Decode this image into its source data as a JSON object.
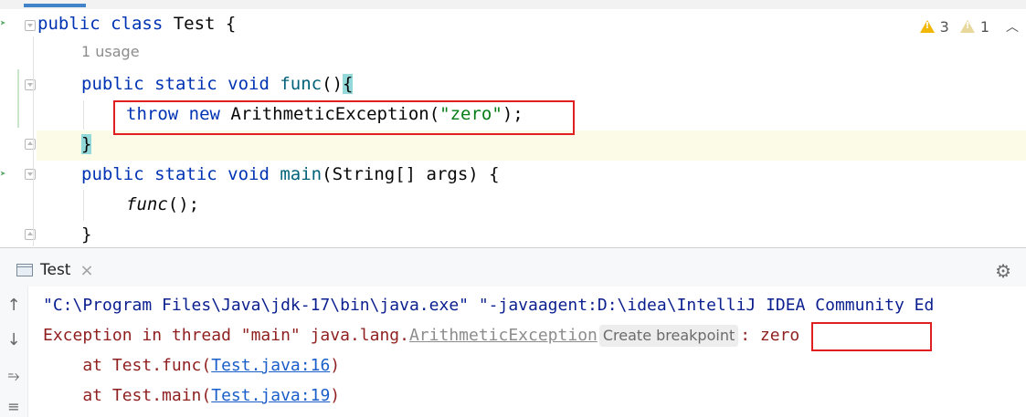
{
  "editor": {
    "lines": {
      "class_decl": {
        "kw": "public class",
        "rest": " Test {"
      },
      "usage_hint": "1 usage",
      "func_decl": {
        "kw": "public static void",
        "name": "func",
        "parens": "()",
        "brace": "{"
      },
      "throw_stmt": {
        "kw": "throw new",
        "type": " ArithmeticException(",
        "str": "\"zero\"",
        "end": ");"
      },
      "func_close": "}",
      "main_decl": {
        "kw": "public static void",
        "name": "main",
        "rest": "(String[] args) {"
      },
      "call": {
        "name": "func",
        "rest": "();"
      },
      "main_close": "}"
    },
    "inspections": {
      "warnings": "3",
      "weak_warnings": "1"
    }
  },
  "run": {
    "tab_label": "Test",
    "console": {
      "cmd_line": "\"C:\\Program Files\\Java\\jdk-17\\bin\\java.exe\" \"-javaagent:D:\\idea\\IntelliJ IDEA Community Ed",
      "exception": {
        "prefix": "Exception in thread \"main\" java.lang.",
        "class_link": "ArithmeticException",
        "breakpoint_btn": "Create breakpoint",
        "message": ": zero"
      },
      "trace": [
        {
          "at": "    at Test.func(",
          "link": "Test.java:16",
          "end": ")"
        },
        {
          "at": "    at Test.main(",
          "link": "Test.java:19",
          "end": ")"
        }
      ]
    }
  },
  "colors": {
    "keyword": "#0033b3",
    "function": "#00627a",
    "string": "#067d17",
    "error_text": "#8f1f1f",
    "link": "#1a5ec9",
    "highlight_box": "#e02020"
  },
  "icons": [
    "run-gutter-icon",
    "fold-icon",
    "warning-icon",
    "weak-warning-icon",
    "chevron-up-icon",
    "console-tab-icon",
    "close-icon",
    "gear-icon",
    "arrow-up-icon",
    "arrow-down-icon",
    "soft-wrap-icon",
    "scroll-end-icon"
  ]
}
